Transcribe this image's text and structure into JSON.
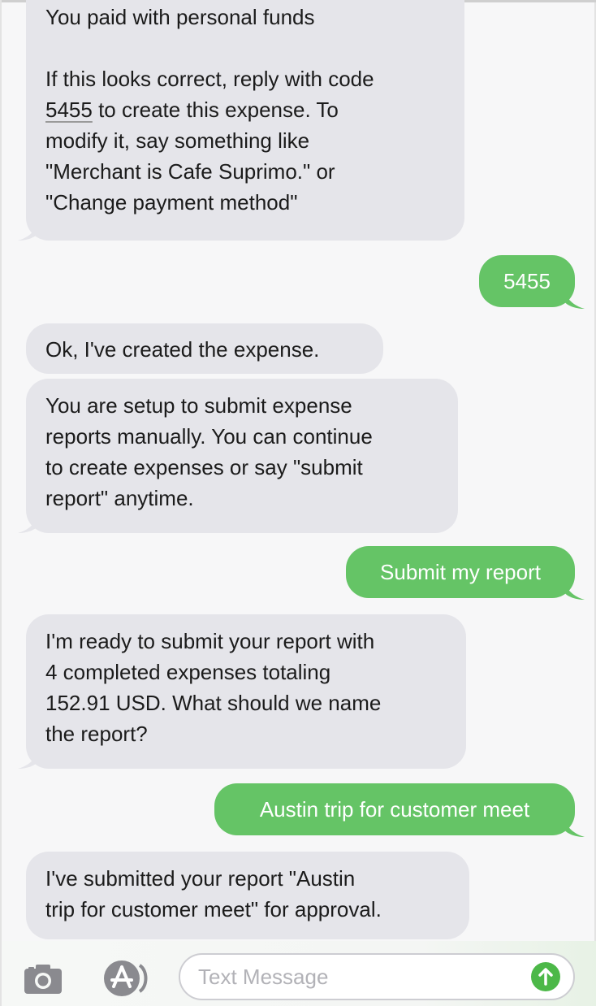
{
  "conversation": {
    "messages": [
      {
        "direction": "incoming",
        "text_before_code": "You paid with personal funds\n\nIf this looks correct, reply with code\n",
        "code": "5455",
        "text_after_code": " to create this expense. To\nmodify it, say something like\n\"Merchant is Cafe Suprimo.\" or\n\"Change payment method\""
      },
      {
        "direction": "outgoing",
        "text": "5455"
      },
      {
        "direction": "incoming",
        "text": "Ok, I've created the expense."
      },
      {
        "direction": "incoming",
        "text": "You are setup to submit expense\nreports manually. You can continue\nto create expenses or say \"submit\nreport\" anytime."
      },
      {
        "direction": "outgoing",
        "text": "Submit my report"
      },
      {
        "direction": "incoming",
        "text": "I'm ready to submit your report with\n4 completed expenses totaling\n152.91 USD. What should we name\nthe report?"
      },
      {
        "direction": "outgoing",
        "text": "Austin trip for customer meet"
      },
      {
        "direction": "incoming",
        "text": "I've submitted your report \"Austin\ntrip for customer meet\" for approval."
      }
    ]
  },
  "composer": {
    "placeholder": "Text Message",
    "camera_icon": "camera-icon",
    "appstore_icon": "app-store-icon",
    "send_icon": "send-arrow-icon"
  },
  "colors": {
    "incoming_bubble": "#e5e5ea",
    "outgoing_bubble": "#65c466",
    "send_button": "#4cb848"
  }
}
